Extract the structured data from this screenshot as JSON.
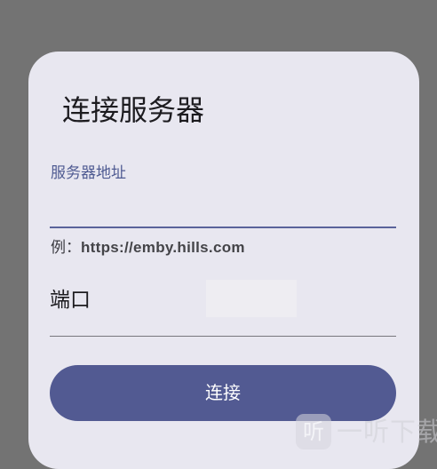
{
  "dialog": {
    "title": "连接服务器",
    "server_field": {
      "label": "服务器地址",
      "value": "",
      "hint_prefix": "例：",
      "hint_example": "https://emby.hills.com"
    },
    "port_field": {
      "label": "端口",
      "value": ""
    },
    "connect_label": "连接"
  },
  "watermark": {
    "badge_text": "听",
    "text": "一听下载"
  },
  "colors": {
    "backdrop": "#737373",
    "dialog_surface": "#e8e7f0",
    "accent": "#525a92",
    "label_accent": "#4f5b92"
  }
}
